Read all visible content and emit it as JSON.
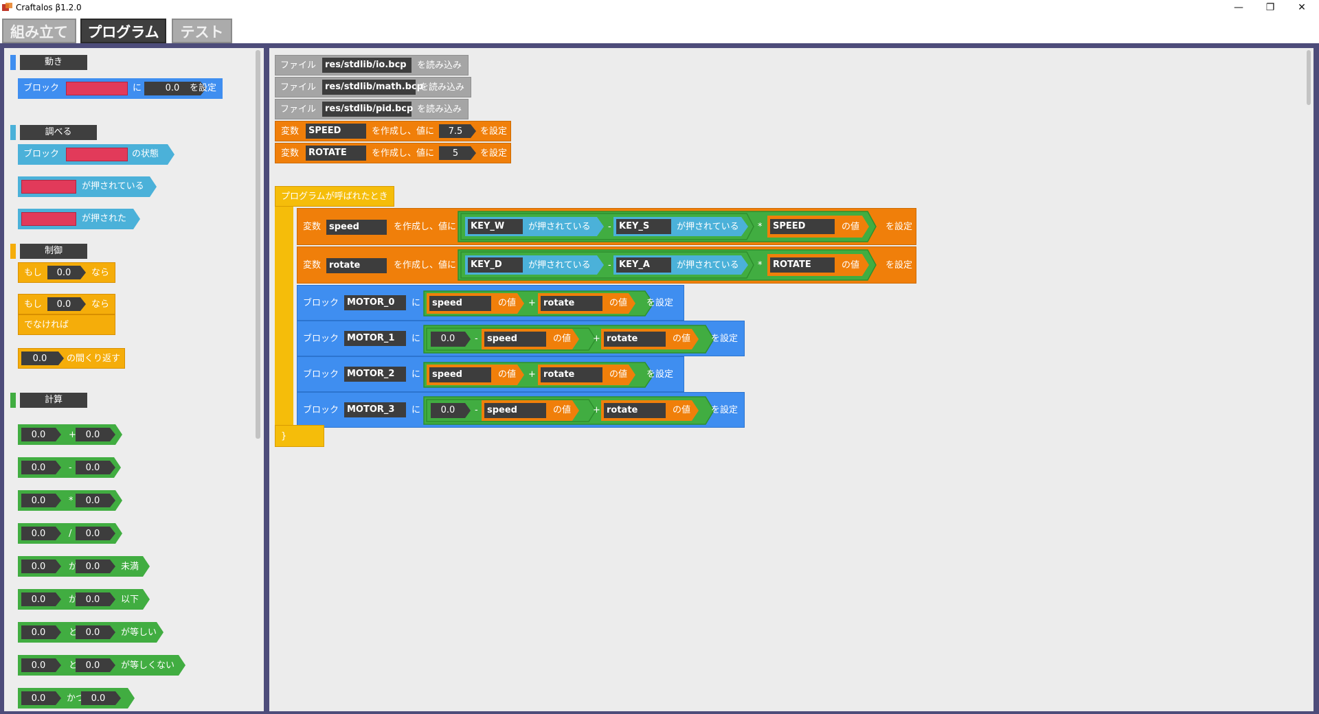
{
  "window": {
    "title": "Craftalos β1.2.0",
    "minimize": "—",
    "restore": "❐",
    "close": "✕"
  },
  "tabs": [
    {
      "label": "組み立て",
      "active": false
    },
    {
      "label": "プログラム",
      "active": true
    },
    {
      "label": "テスト",
      "active": false
    }
  ],
  "colors": {
    "move": "#3f8ef0",
    "sense": "#4bb1d9",
    "control": "#f5ad0a",
    "calc": "#41ad41",
    "var": "#f07f0a",
    "file": "#a5a5a5",
    "slot": "#3d3d3d",
    "frame": "#4d4c7a"
  },
  "palette": {
    "categories": {
      "move": "動き",
      "sense": "調べる",
      "control": "制御",
      "calc": "計算"
    },
    "move_block": {
      "p1": "ブロック",
      "p2": "に",
      "value": "0.0",
      "p3": "を設定"
    },
    "sense_state": {
      "p1": "ブロック",
      "p2": "の状態"
    },
    "sense_pressing": "が押されている",
    "sense_pressed": "が押された",
    "if_block": {
      "if": "もし",
      "value": "0.0",
      "then": "なら"
    },
    "ifelse_block": {
      "if": "もし",
      "value": "0.0",
      "then": "なら",
      "else": "でなければ"
    },
    "repeat_block": {
      "value": "0.0",
      "label": "の間くり返す"
    },
    "calc_blocks": [
      {
        "a": "0.0",
        "op": "+",
        "b": "0.0",
        "suffix": ""
      },
      {
        "a": "0.0",
        "op": "-",
        "b": "0.0",
        "suffix": ""
      },
      {
        "a": "0.0",
        "op": "*",
        "b": "0.0",
        "suffix": ""
      },
      {
        "a": "0.0",
        "op": "/",
        "b": "0.0",
        "suffix": ""
      },
      {
        "a": "0.0",
        "op": "が",
        "b": "0.0",
        "suffix": "未満"
      },
      {
        "a": "0.0",
        "op": "が",
        "b": "0.0",
        "suffix": "以下"
      },
      {
        "a": "0.0",
        "op": "と",
        "b": "0.0",
        "suffix": "が等しい"
      },
      {
        "a": "0.0",
        "op": "と",
        "b": "0.0",
        "suffix": "が等しくない"
      },
      {
        "a": "0.0",
        "op": "かつ",
        "b": "0.0",
        "suffix": ""
      }
    ]
  },
  "program": {
    "files": [
      {
        "label": "ファイル",
        "path": "res/stdlib/io.bcp",
        "suffix": "を読み込み"
      },
      {
        "label": "ファイル",
        "path": "res/stdlib/math.bcp",
        "suffix": "を読み込み"
      },
      {
        "label": "ファイル",
        "path": "res/stdlib/pid.bcp",
        "suffix": "を読み込み"
      }
    ],
    "globals": [
      {
        "label": "変数",
        "name": "SPEED",
        "mid": "を作成し、値に",
        "value": "7.5",
        "suffix": "を設定"
      },
      {
        "label": "変数",
        "name": "ROTATE",
        "mid": "を作成し、値に",
        "value": "5",
        "suffix": "を設定"
      }
    ],
    "main": {
      "header": "プログラムが呼ばれたとき",
      "footer": "}",
      "locals": [
        {
          "label": "変数",
          "name": "speed",
          "mid": "を作成し、値に",
          "key1": "KEY_W",
          "key2": "KEY_S",
          "pressing": "が押されている",
          "minus": "-",
          "times": "*",
          "ref": "SPEED",
          "value_of": "の値",
          "suffix": "を設定"
        },
        {
          "label": "変数",
          "name": "rotate",
          "mid": "を作成し、値に",
          "key1": "KEY_D",
          "key2": "KEY_A",
          "pressing": "が押されている",
          "minus": "-",
          "times": "*",
          "ref": "ROTATE",
          "value_of": "の値",
          "suffix": "を設定"
        }
      ],
      "motors": [
        {
          "label": "ブロック",
          "name": "MOTOR_0",
          "ni": "に",
          "zero": "",
          "minus": "",
          "a": "speed",
          "plus": "+",
          "b": "rotate",
          "value_of": "の値",
          "suffix": "を設定"
        },
        {
          "label": "ブロック",
          "name": "MOTOR_1",
          "ni": "に",
          "zero": "0.0",
          "minus": "-",
          "a": "speed",
          "plus": "+",
          "b": "rotate",
          "value_of": "の値",
          "suffix": "を設定"
        },
        {
          "label": "ブロック",
          "name": "MOTOR_2",
          "ni": "に",
          "zero": "",
          "minus": "",
          "a": "speed",
          "plus": "+",
          "b": "rotate",
          "value_of": "の値",
          "suffix": "を設定"
        },
        {
          "label": "ブロック",
          "name": "MOTOR_3",
          "ni": "に",
          "zero": "0.0",
          "minus": "-",
          "a": "speed",
          "plus": "+",
          "b": "rotate",
          "value_of": "の値",
          "suffix": "を設定"
        }
      ]
    }
  }
}
